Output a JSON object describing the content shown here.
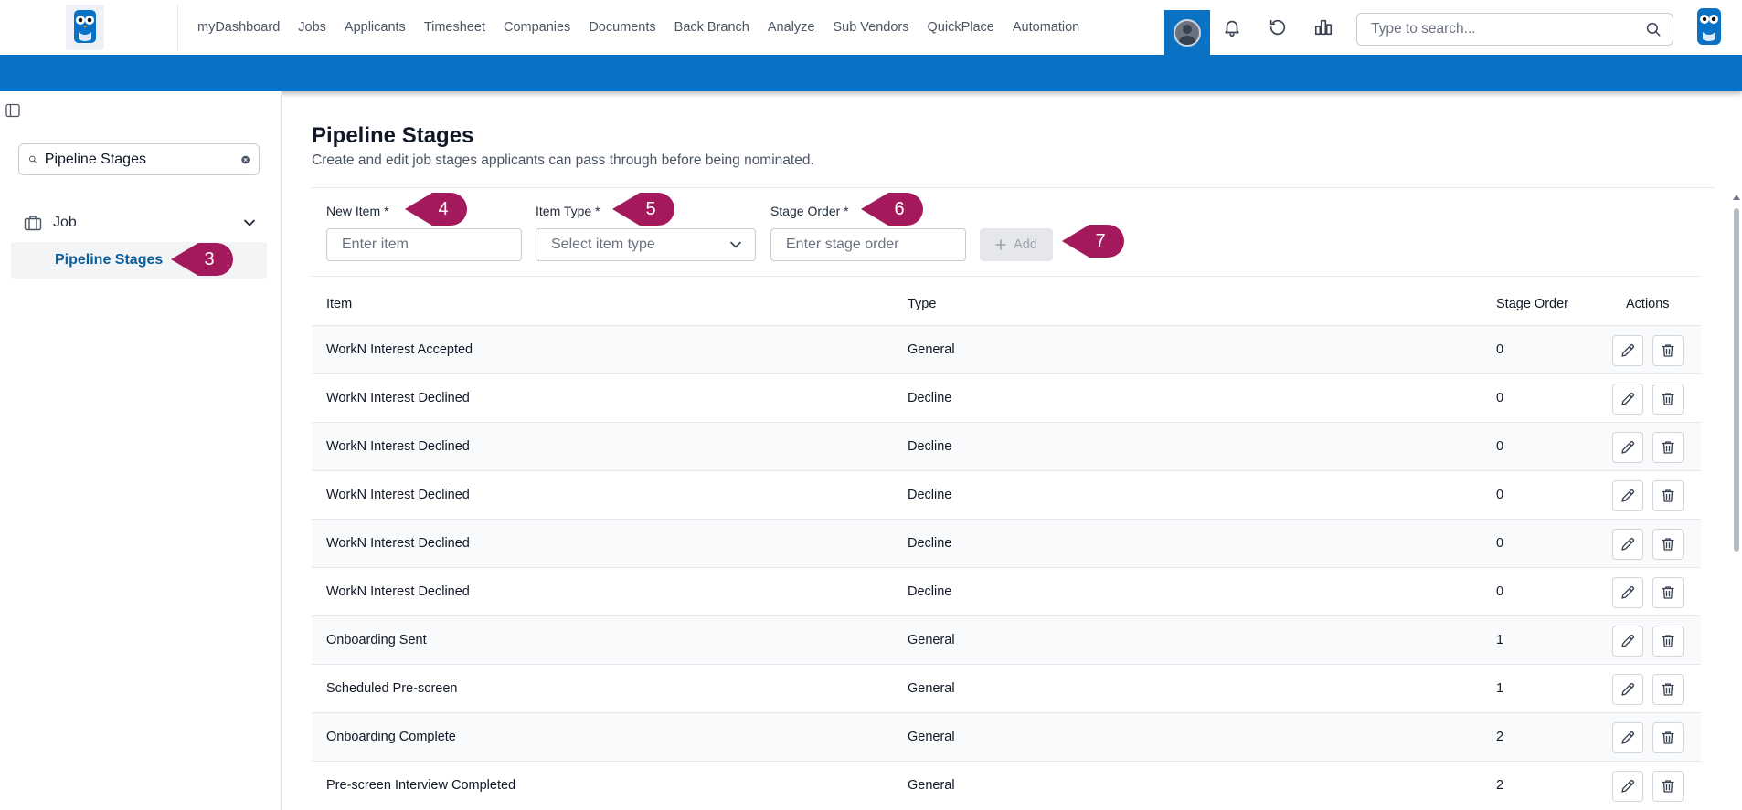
{
  "nav": {
    "items": [
      "myDashboard",
      "Jobs",
      "Applicants",
      "Timesheet",
      "Companies",
      "Documents",
      "Back Branch",
      "Analyze",
      "Sub Vendors",
      "QuickPlace",
      "Automation"
    ]
  },
  "search": {
    "placeholder": "Type to search..."
  },
  "sidebar": {
    "search_value": "Pipeline Stages",
    "group_label": "Job",
    "active_item": "Pipeline Stages"
  },
  "markers": {
    "m3": "3",
    "m4": "4",
    "m5": "5",
    "m6": "6",
    "m7": "7"
  },
  "page": {
    "title": "Pipeline Stages",
    "subtitle": "Create and edit job stages applicants can pass through before being nominated."
  },
  "form": {
    "item_label": "New Item *",
    "item_placeholder": "Enter item",
    "type_label": "Item Type *",
    "type_placeholder": "Select item type",
    "order_label": "Stage Order *",
    "order_placeholder": "Enter stage order",
    "add_label": "Add"
  },
  "table": {
    "headers": {
      "item": "Item",
      "type": "Type",
      "order": "Stage Order",
      "actions": "Actions"
    },
    "rows": [
      {
        "item": "WorkN Interest Accepted",
        "type": "General",
        "order": "0"
      },
      {
        "item": "WorkN Interest Declined",
        "type": "Decline",
        "order": "0"
      },
      {
        "item": "WorkN Interest Declined",
        "type": "Decline",
        "order": "0"
      },
      {
        "item": "WorkN Interest Declined",
        "type": "Decline",
        "order": "0"
      },
      {
        "item": "WorkN Interest Declined",
        "type": "Decline",
        "order": "0"
      },
      {
        "item": "WorkN Interest Declined",
        "type": "Decline",
        "order": "0"
      },
      {
        "item": "Onboarding Sent",
        "type": "General",
        "order": "1"
      },
      {
        "item": "Scheduled Pre-screen",
        "type": "General",
        "order": "1"
      },
      {
        "item": "Onboarding Complete",
        "type": "General",
        "order": "2"
      },
      {
        "item": "Pre-screen Interview Completed",
        "type": "General",
        "order": "2"
      }
    ]
  },
  "colors": {
    "brand_blue": "#0a72c5",
    "marker": "#a3195b",
    "link": "#0a5d9c"
  },
  "icons": {
    "bell": "bell-icon",
    "history": "history-icon",
    "reports": "bar-chart-icon",
    "search": "search-icon",
    "clear": "clear-icon",
    "chevron": "chevron-down-icon",
    "edit": "pencil-icon",
    "delete": "trash-icon",
    "plus": "plus-icon",
    "briefcase": "briefcase-icon",
    "sidebar_toggle": "panel-toggle-icon"
  }
}
